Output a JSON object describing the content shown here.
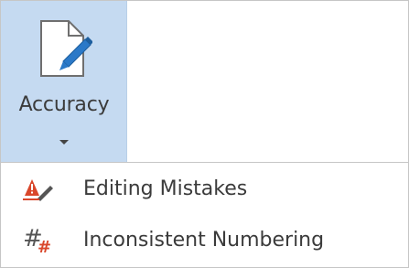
{
  "ribbon": {
    "accuracy_button": {
      "label": "Accuracy",
      "icon": "document-pencil-icon",
      "has_dropdown": true
    }
  },
  "menu": {
    "items": [
      {
        "label": "Editing Mistakes",
        "icon": "editing-mistakes-icon"
      },
      {
        "label": "Inconsistent Numbering",
        "icon": "numbering-icon"
      }
    ]
  },
  "colors": {
    "button_highlight": "#c5daf1",
    "pencil_blue": "#2b79c8",
    "warning_red": "#d9472b",
    "text": "#3b3b3b"
  }
}
